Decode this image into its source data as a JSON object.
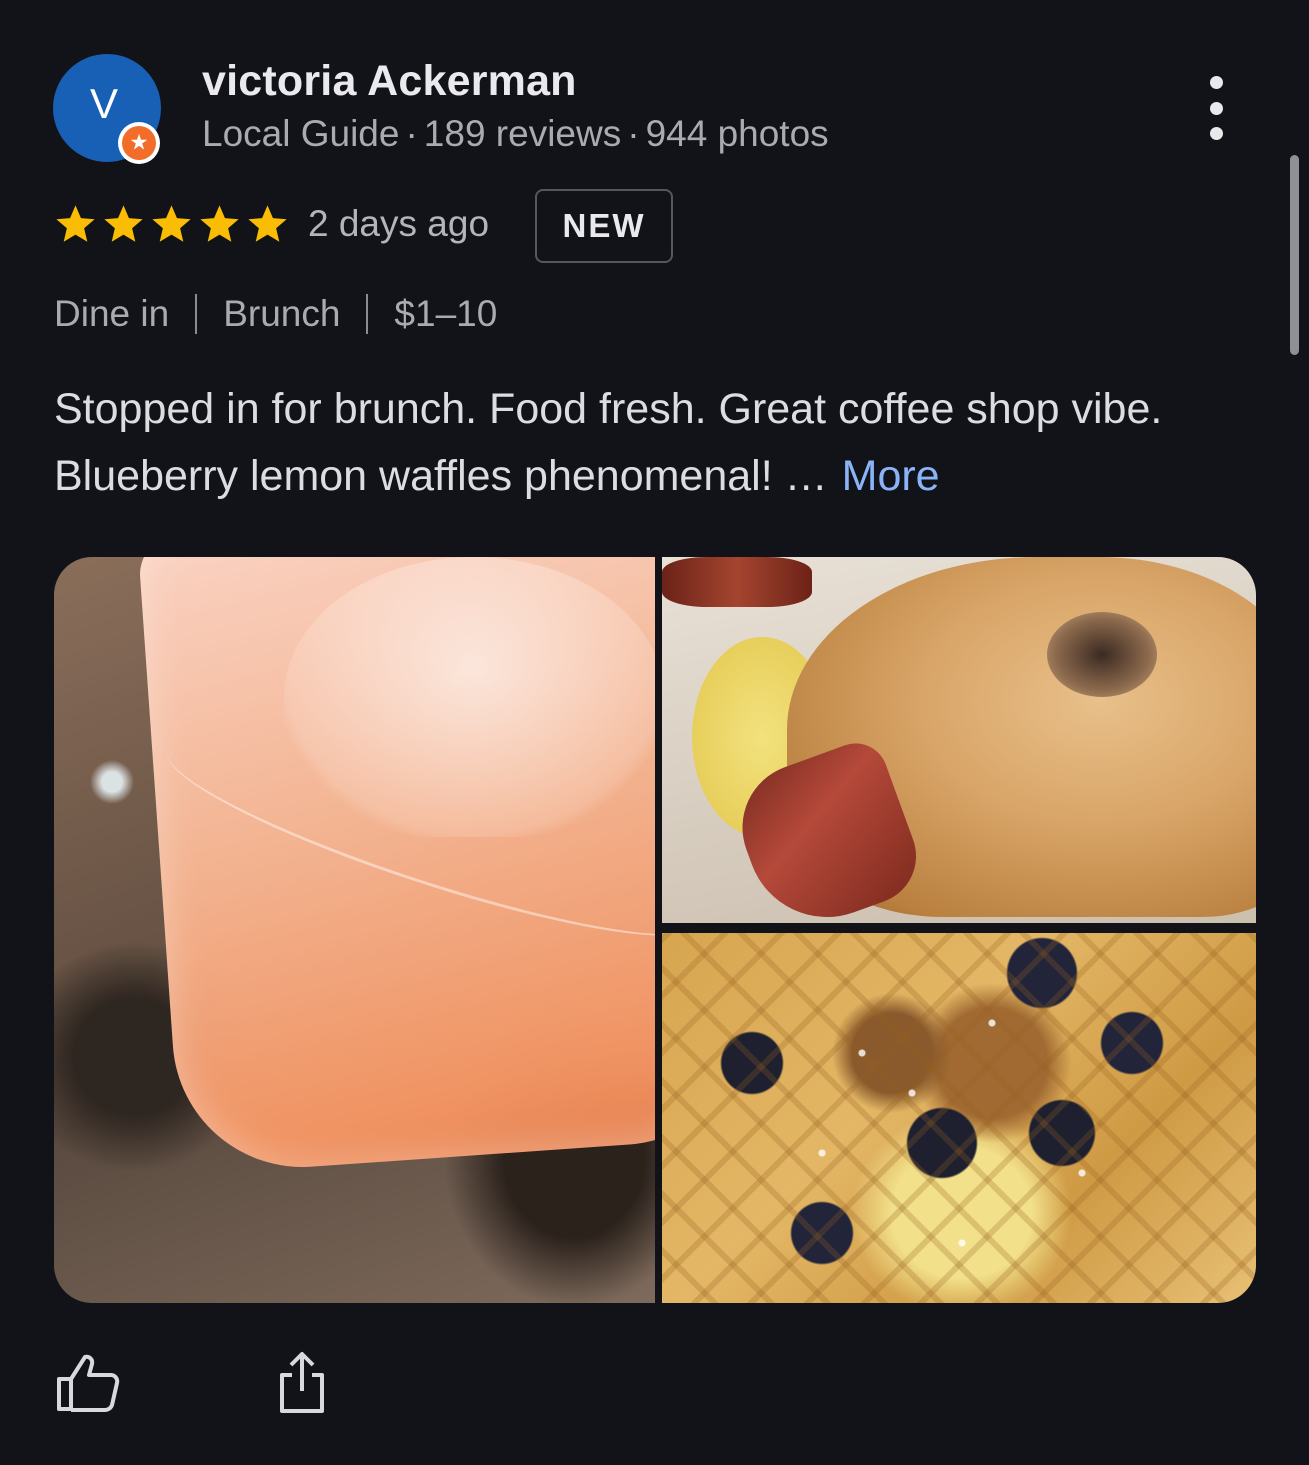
{
  "reviewer": {
    "avatar_letter": "V",
    "name": "victoria Ackerman",
    "level": "Local Guide",
    "reviews": "189 reviews",
    "photos": "944 photos",
    "separator": "·"
  },
  "rating": {
    "stars": 5,
    "max_stars": 5,
    "time_ago": "2 days ago",
    "badge": "NEW"
  },
  "tags": [
    "Dine in",
    "Brunch",
    "$1–10"
  ],
  "review": {
    "text": "Stopped in for brunch. Food fresh. Great coffee shop vibe. Blueberry lemon waffles phenomenal! …",
    "more_label": "More"
  },
  "photos": [
    {
      "subject": "drink"
    },
    {
      "subject": "bagel"
    },
    {
      "subject": "waffle"
    }
  ],
  "colors": {
    "background": "#121318",
    "star": "#fbbc04",
    "link": "#8ab4f8",
    "avatar": "#1760b5",
    "guide_badge": "#f26c2a"
  },
  "icons": {
    "more_options": "vertical-dots-icon",
    "like": "thumbs-up-icon",
    "share": "share-icon",
    "guide": "local-guide-badge-icon"
  }
}
